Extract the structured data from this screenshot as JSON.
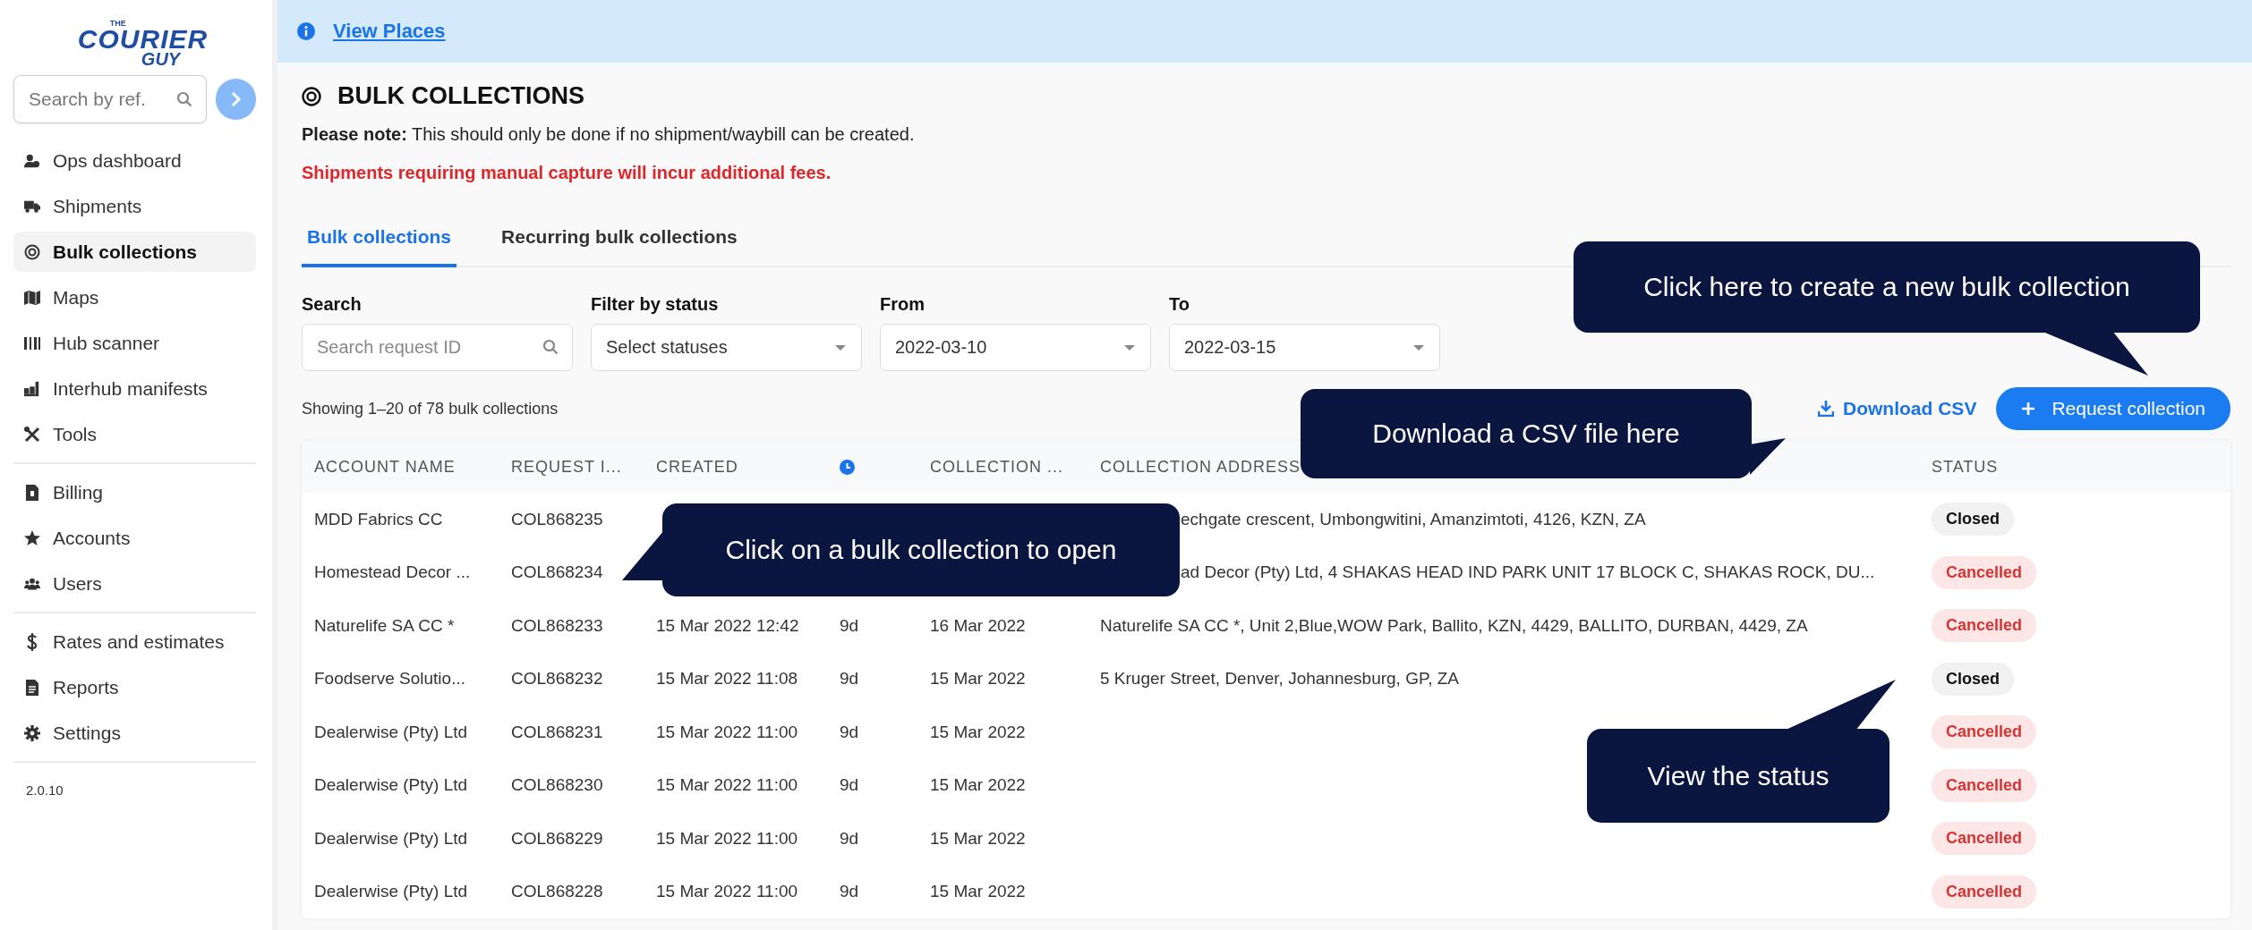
{
  "sidebar": {
    "logo": {
      "top": "THE",
      "main": "COURIER",
      "sub": "GUY"
    },
    "search": {
      "placeholder": "Search by ref."
    },
    "groups": [
      {
        "items": [
          {
            "label": "Ops dashboard",
            "selected": false
          },
          {
            "label": "Shipments",
            "selected": false
          },
          {
            "label": "Bulk collections",
            "selected": true
          },
          {
            "label": "Maps",
            "selected": false
          },
          {
            "label": "Hub scanner",
            "selected": false
          },
          {
            "label": "Interhub manifests",
            "selected": false
          },
          {
            "label": "Tools",
            "selected": false
          }
        ]
      },
      {
        "items": [
          {
            "label": "Billing",
            "selected": false
          },
          {
            "label": "Accounts",
            "selected": false
          },
          {
            "label": "Users",
            "selected": false
          }
        ]
      },
      {
        "items": [
          {
            "label": "Rates and estimates",
            "selected": false
          },
          {
            "label": "Reports",
            "selected": false
          },
          {
            "label": "Settings",
            "selected": false
          }
        ]
      }
    ],
    "version": "2.0.10"
  },
  "banner": {
    "link": "View Places"
  },
  "page": {
    "title": "BULK COLLECTIONS",
    "note": "**Please note:** This should only be done if no shipment/waybill can be created.",
    "warning": "Shipments requiring manual capture will incur additional fees."
  },
  "tabs": [
    {
      "label": "Bulk collections",
      "selected": true
    },
    {
      "label": "Recurring bulk collections",
      "selected": false
    }
  ],
  "filters": [
    {
      "label": "Search",
      "kind": "search",
      "placeholder": "Search request ID"
    },
    {
      "label": "Filter by status",
      "kind": "select",
      "placeholder": "Select statuses"
    },
    {
      "label": "From",
      "kind": "select",
      "value": "2022-03-10"
    },
    {
      "label": "To",
      "kind": "select",
      "value": "2022-03-15"
    }
  ],
  "summary": "Showing 1–20 of 78 bulk collections",
  "actions": {
    "download": "Download CSV",
    "request": "Request collection"
  },
  "table": {
    "columns": [
      {
        "kind": "text",
        "label": "ACCOUNT NAME"
      },
      {
        "kind": "text",
        "label": "REQUEST I..."
      },
      {
        "kind": "text",
        "label": "CREATED"
      },
      {
        "kind": "icon"
      },
      {
        "kind": "text",
        "label": "COLLECTION ..."
      },
      {
        "kind": "text",
        "label": "COLLECTION ADDRESS"
      },
      {
        "kind": "text",
        "label": "STATUS"
      }
    ],
    "rows": [
      {
        "account": "MDD Fabrics CC",
        "request_id": "COL868235",
        "address": "echgate crescent, Umbongwitini, Amanzimtoti, 4126, KZN, ZA",
        "status": {
          "label": "Closed",
          "kind": "closed"
        }
      },
      {
        "account": "Homestead Decor ...",
        "request_id": "COL868234",
        "address": "ad Decor (Pty) Ltd, 4 SHAKAS HEAD IND PARK UNIT 17 BLOCK C, SHAKAS ROCK, DU...",
        "status": {
          "label": "Cancelled",
          "kind": "cancelled"
        }
      },
      {
        "account": "Naturelife SA CC *",
        "request_id": "COL868233",
        "created": "15 Mar 2022 12:42",
        "age": "9d",
        "collection_date": "16 Mar 2022",
        "address": "Naturelife SA CC *, Unit 2,Blue,WOW Park, Ballito, KZN, 4429, BALLITO, DURBAN, 4429, ZA",
        "status": {
          "label": "Cancelled",
          "kind": "cancelled"
        }
      },
      {
        "account": "Foodserve Solutio...",
        "request_id": "COL868232",
        "created": "15 Mar 2022 11:08",
        "age": "9d",
        "collection_date": "15 Mar 2022",
        "address": "5 Kruger Street, Denver, Johannesburg, GP, ZA",
        "status": {
          "label": "Closed",
          "kind": "closed"
        }
      },
      {
        "account": "Dealerwise (Pty) Ltd",
        "request_id": "COL868231",
        "created": "15 Mar 2022 11:00",
        "age": "9d",
        "collection_date": "15 Mar 2022",
        "status": {
          "label": "Cancelled",
          "kind": "cancelled"
        }
      },
      {
        "account": "Dealerwise (Pty) Ltd",
        "request_id": "COL868230",
        "created": "15 Mar 2022 11:00",
        "age": "9d",
        "collection_date": "15 Mar 2022",
        "status": {
          "label": "Cancelled",
          "kind": "cancelled"
        }
      },
      {
        "account": "Dealerwise (Pty) Ltd",
        "request_id": "COL868229",
        "created": "15 Mar 2022 11:00",
        "age": "9d",
        "collection_date": "15 Mar 2022",
        "status": {
          "label": "Cancelled",
          "kind": "cancelled"
        }
      },
      {
        "account": "Dealerwise (Pty) Ltd",
        "request_id": "COL868228",
        "created": "15 Mar 2022 11:00",
        "age": "9d",
        "collection_date": "15 Mar 2022",
        "status": {
          "label": "Cancelled",
          "kind": "cancelled"
        }
      }
    ]
  },
  "callouts": [
    {
      "text": "Click here to create a new bulk collection"
    },
    {
      "text": "Download a CSV file here"
    },
    {
      "text": "Click on a bulk collection to open"
    },
    {
      "text": "View the status"
    }
  ]
}
